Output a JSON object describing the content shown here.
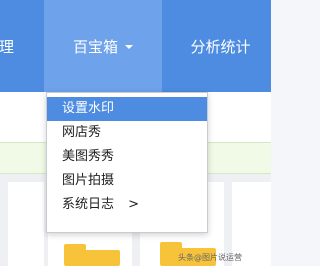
{
  "navbar": {
    "left_label": "理",
    "active_label": "百宝箱",
    "right_label": "分析统计"
  },
  "dropdown": {
    "items": [
      {
        "label": "设置水印"
      },
      {
        "label": "网店秀"
      },
      {
        "label": "美图秀秀"
      },
      {
        "label": "图片拍摄"
      },
      {
        "label": "系统日志",
        "arrow": ">"
      }
    ]
  },
  "watermark": {
    "text": "头条@图片说运营"
  },
  "colors": {
    "nav_bg": "#4d8ce0",
    "nav_active_bg": "#6ea2ea",
    "menu_active_bg": "#4d8ce0",
    "folder": "#f6c33a",
    "green_strip": "#f1f9e7"
  },
  "icons": [
    "chevron-down-icon",
    "chevron-right-icon",
    "folder-icon",
    "watermark-icon"
  ]
}
